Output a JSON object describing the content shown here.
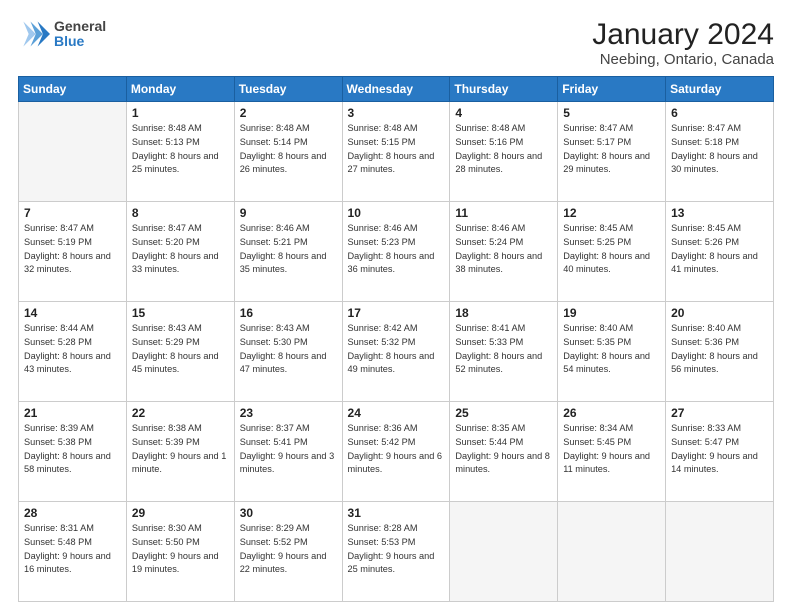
{
  "header": {
    "logo_line1": "General",
    "logo_line2": "Blue",
    "title": "January 2024",
    "subtitle": "Neebing, Ontario, Canada"
  },
  "calendar": {
    "days_of_week": [
      "Sunday",
      "Monday",
      "Tuesday",
      "Wednesday",
      "Thursday",
      "Friday",
      "Saturday"
    ],
    "weeks": [
      [
        {
          "day": "",
          "sunrise": "",
          "sunset": "",
          "daylight": ""
        },
        {
          "day": "1",
          "sunrise": "Sunrise: 8:48 AM",
          "sunset": "Sunset: 5:13 PM",
          "daylight": "Daylight: 8 hours and 25 minutes."
        },
        {
          "day": "2",
          "sunrise": "Sunrise: 8:48 AM",
          "sunset": "Sunset: 5:14 PM",
          "daylight": "Daylight: 8 hours and 26 minutes."
        },
        {
          "day": "3",
          "sunrise": "Sunrise: 8:48 AM",
          "sunset": "Sunset: 5:15 PM",
          "daylight": "Daylight: 8 hours and 27 minutes."
        },
        {
          "day": "4",
          "sunrise": "Sunrise: 8:48 AM",
          "sunset": "Sunset: 5:16 PM",
          "daylight": "Daylight: 8 hours and 28 minutes."
        },
        {
          "day": "5",
          "sunrise": "Sunrise: 8:47 AM",
          "sunset": "Sunset: 5:17 PM",
          "daylight": "Daylight: 8 hours and 29 minutes."
        },
        {
          "day": "6",
          "sunrise": "Sunrise: 8:47 AM",
          "sunset": "Sunset: 5:18 PM",
          "daylight": "Daylight: 8 hours and 30 minutes."
        }
      ],
      [
        {
          "day": "7",
          "sunrise": "Sunrise: 8:47 AM",
          "sunset": "Sunset: 5:19 PM",
          "daylight": "Daylight: 8 hours and 32 minutes."
        },
        {
          "day": "8",
          "sunrise": "Sunrise: 8:47 AM",
          "sunset": "Sunset: 5:20 PM",
          "daylight": "Daylight: 8 hours and 33 minutes."
        },
        {
          "day": "9",
          "sunrise": "Sunrise: 8:46 AM",
          "sunset": "Sunset: 5:21 PM",
          "daylight": "Daylight: 8 hours and 35 minutes."
        },
        {
          "day": "10",
          "sunrise": "Sunrise: 8:46 AM",
          "sunset": "Sunset: 5:23 PM",
          "daylight": "Daylight: 8 hours and 36 minutes."
        },
        {
          "day": "11",
          "sunrise": "Sunrise: 8:46 AM",
          "sunset": "Sunset: 5:24 PM",
          "daylight": "Daylight: 8 hours and 38 minutes."
        },
        {
          "day": "12",
          "sunrise": "Sunrise: 8:45 AM",
          "sunset": "Sunset: 5:25 PM",
          "daylight": "Daylight: 8 hours and 40 minutes."
        },
        {
          "day": "13",
          "sunrise": "Sunrise: 8:45 AM",
          "sunset": "Sunset: 5:26 PM",
          "daylight": "Daylight: 8 hours and 41 minutes."
        }
      ],
      [
        {
          "day": "14",
          "sunrise": "Sunrise: 8:44 AM",
          "sunset": "Sunset: 5:28 PM",
          "daylight": "Daylight: 8 hours and 43 minutes."
        },
        {
          "day": "15",
          "sunrise": "Sunrise: 8:43 AM",
          "sunset": "Sunset: 5:29 PM",
          "daylight": "Daylight: 8 hours and 45 minutes."
        },
        {
          "day": "16",
          "sunrise": "Sunrise: 8:43 AM",
          "sunset": "Sunset: 5:30 PM",
          "daylight": "Daylight: 8 hours and 47 minutes."
        },
        {
          "day": "17",
          "sunrise": "Sunrise: 8:42 AM",
          "sunset": "Sunset: 5:32 PM",
          "daylight": "Daylight: 8 hours and 49 minutes."
        },
        {
          "day": "18",
          "sunrise": "Sunrise: 8:41 AM",
          "sunset": "Sunset: 5:33 PM",
          "daylight": "Daylight: 8 hours and 52 minutes."
        },
        {
          "day": "19",
          "sunrise": "Sunrise: 8:40 AM",
          "sunset": "Sunset: 5:35 PM",
          "daylight": "Daylight: 8 hours and 54 minutes."
        },
        {
          "day": "20",
          "sunrise": "Sunrise: 8:40 AM",
          "sunset": "Sunset: 5:36 PM",
          "daylight": "Daylight: 8 hours and 56 minutes."
        }
      ],
      [
        {
          "day": "21",
          "sunrise": "Sunrise: 8:39 AM",
          "sunset": "Sunset: 5:38 PM",
          "daylight": "Daylight: 8 hours and 58 minutes."
        },
        {
          "day": "22",
          "sunrise": "Sunrise: 8:38 AM",
          "sunset": "Sunset: 5:39 PM",
          "daylight": "Daylight: 9 hours and 1 minute."
        },
        {
          "day": "23",
          "sunrise": "Sunrise: 8:37 AM",
          "sunset": "Sunset: 5:41 PM",
          "daylight": "Daylight: 9 hours and 3 minutes."
        },
        {
          "day": "24",
          "sunrise": "Sunrise: 8:36 AM",
          "sunset": "Sunset: 5:42 PM",
          "daylight": "Daylight: 9 hours and 6 minutes."
        },
        {
          "day": "25",
          "sunrise": "Sunrise: 8:35 AM",
          "sunset": "Sunset: 5:44 PM",
          "daylight": "Daylight: 9 hours and 8 minutes."
        },
        {
          "day": "26",
          "sunrise": "Sunrise: 8:34 AM",
          "sunset": "Sunset: 5:45 PM",
          "daylight": "Daylight: 9 hours and 11 minutes."
        },
        {
          "day": "27",
          "sunrise": "Sunrise: 8:33 AM",
          "sunset": "Sunset: 5:47 PM",
          "daylight": "Daylight: 9 hours and 14 minutes."
        }
      ],
      [
        {
          "day": "28",
          "sunrise": "Sunrise: 8:31 AM",
          "sunset": "Sunset: 5:48 PM",
          "daylight": "Daylight: 9 hours and 16 minutes."
        },
        {
          "day": "29",
          "sunrise": "Sunrise: 8:30 AM",
          "sunset": "Sunset: 5:50 PM",
          "daylight": "Daylight: 9 hours and 19 minutes."
        },
        {
          "day": "30",
          "sunrise": "Sunrise: 8:29 AM",
          "sunset": "Sunset: 5:52 PM",
          "daylight": "Daylight: 9 hours and 22 minutes."
        },
        {
          "day": "31",
          "sunrise": "Sunrise: 8:28 AM",
          "sunset": "Sunset: 5:53 PM",
          "daylight": "Daylight: 9 hours and 25 minutes."
        },
        {
          "day": "",
          "sunrise": "",
          "sunset": "",
          "daylight": ""
        },
        {
          "day": "",
          "sunrise": "",
          "sunset": "",
          "daylight": ""
        },
        {
          "day": "",
          "sunrise": "",
          "sunset": "",
          "daylight": ""
        }
      ]
    ]
  }
}
